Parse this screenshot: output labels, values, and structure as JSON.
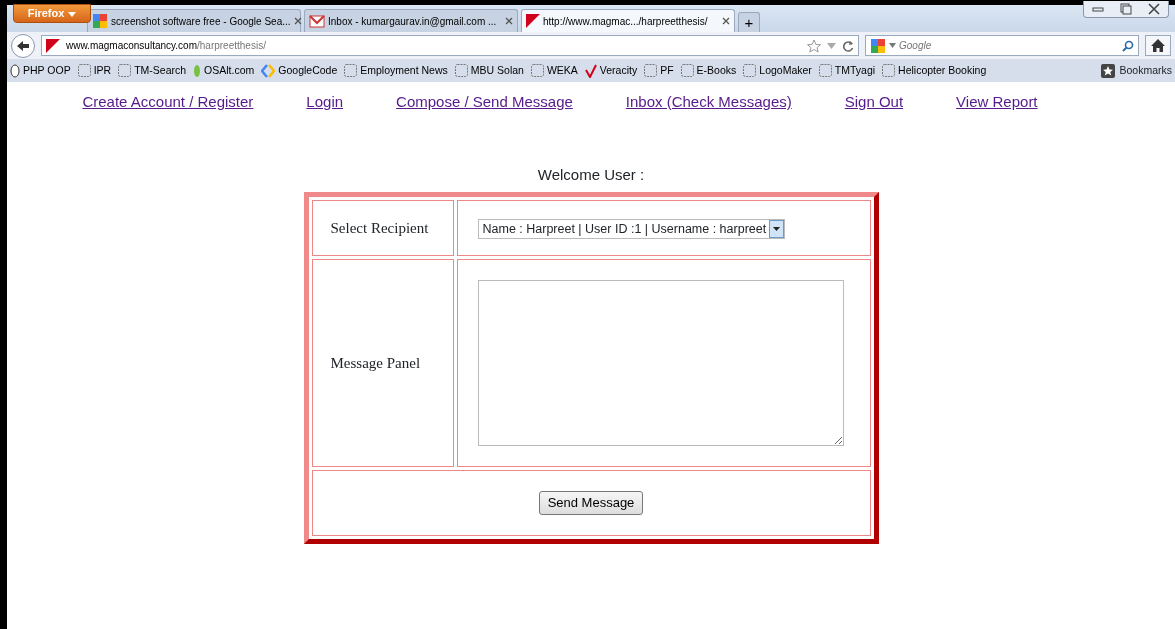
{
  "browser": {
    "menu_button": "Firefox",
    "tabs": [
      {
        "title": "screenshot software free - Google Sea...",
        "kind": "google",
        "selected": false
      },
      {
        "title": "Inbox - kumargaurav.in@gmail.com ...",
        "kind": "mail",
        "selected": false
      },
      {
        "title": "http://www.magmac.../harpreetthesis/",
        "kind": "site",
        "selected": true
      }
    ],
    "new_tab": "+",
    "address": {
      "domain": "www.magmaconsultancy.com",
      "path": "/harpreetthesis/"
    },
    "search": {
      "placeholder": "Google"
    },
    "bookmarks": [
      {
        "label": "PHP OOP",
        "kind": "oval"
      },
      {
        "label": "IPR",
        "kind": "blank"
      },
      {
        "label": "TM-Search",
        "kind": "blank"
      },
      {
        "label": "OSAlt.com",
        "kind": "leaf"
      },
      {
        "label": "GoogleCode",
        "kind": "code"
      },
      {
        "label": "Employment News",
        "kind": "blank"
      },
      {
        "label": "MBU Solan",
        "kind": "blank"
      },
      {
        "label": "WEKA",
        "kind": "blank"
      },
      {
        "label": "Veracity",
        "kind": "check"
      },
      {
        "label": "PF",
        "kind": "blank"
      },
      {
        "label": "E-Books",
        "kind": "blank"
      },
      {
        "label": "LogoMaker",
        "kind": "blank"
      },
      {
        "label": "TMTyagi",
        "kind": "blank"
      },
      {
        "label": "Helicopter Booking",
        "kind": "blank"
      }
    ],
    "bookmarks_menu": "Bookmarks"
  },
  "page": {
    "nav_links": [
      "Create Account / Register",
      "Login",
      "Compose / Send Message",
      "Inbox (Check Messages)",
      "Sign Out",
      "View Report"
    ],
    "welcome": "Welcome User :",
    "form": {
      "recipient_label": "Select Recipient",
      "recipient_value": "Name : Harpreet | User ID :1 | Username : harpreet",
      "message_label": "Message Panel",
      "send_button": "Send Message"
    }
  }
}
